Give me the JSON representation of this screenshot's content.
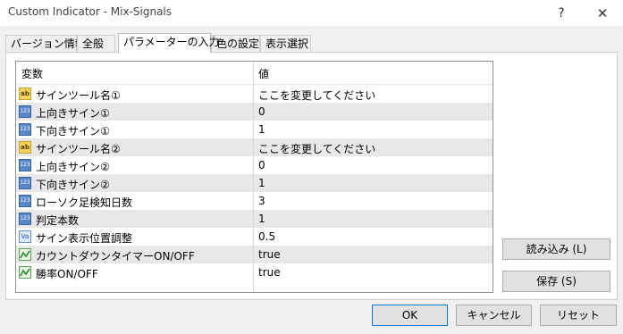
{
  "window": {
    "title": "Custom Indicator - Mix-Signals",
    "help": "?",
    "close": "✕"
  },
  "tabs": [
    {
      "label": "バージョン情報"
    },
    {
      "label": "全般"
    },
    {
      "label": "パラメーターの入力"
    },
    {
      "label": "色の設定"
    },
    {
      "label": "表示選択"
    }
  ],
  "table": {
    "columns": {
      "name": "変数",
      "value": "値"
    },
    "rows": [
      {
        "icon": "ab",
        "name": "サインツール名①",
        "value": "ここを変更してください"
      },
      {
        "icon": "123",
        "name": "上向きサイン①",
        "value": "0"
      },
      {
        "icon": "123",
        "name": "下向きサイン①",
        "value": "1"
      },
      {
        "icon": "ab",
        "name": "サインツール名②",
        "value": "ここを変更してください"
      },
      {
        "icon": "123",
        "name": "上向きサイン②",
        "value": "0"
      },
      {
        "icon": "123",
        "name": "下向きサイン②",
        "value": "1"
      },
      {
        "icon": "123",
        "name": "ローソク足検知日数",
        "value": "3"
      },
      {
        "icon": "123",
        "name": "判定本数",
        "value": "1"
      },
      {
        "icon": "Va",
        "name": "サイン表示位置調整",
        "value": "0.5"
      },
      {
        "icon": "bool",
        "name": "カウントダウンタイマーON/OFF",
        "value": "true"
      },
      {
        "icon": "bool",
        "name": "勝率ON/OFF",
        "value": "true"
      }
    ]
  },
  "side_buttons": {
    "load": "読み込み (L)",
    "save": "保存 (S)"
  },
  "footer_buttons": {
    "ok": "OK",
    "cancel": "キャンセル",
    "reset": "リセット"
  }
}
